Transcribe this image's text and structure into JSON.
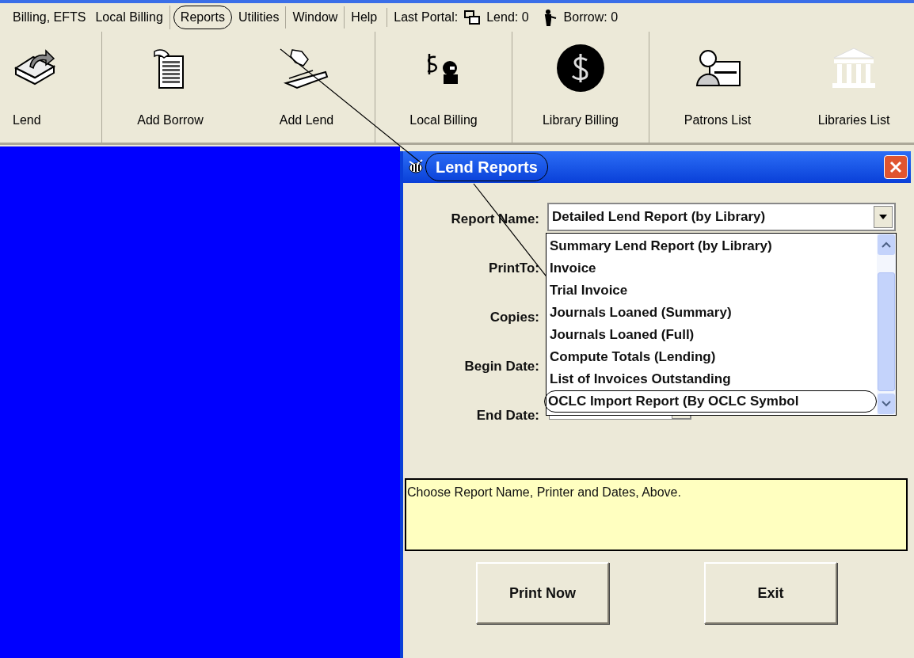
{
  "menu": {
    "groups": [
      [
        {
          "label": "Billing, EFTS",
          "circled": false
        },
        {
          "label": "Local Billing",
          "circled": false
        }
      ],
      [
        {
          "label": "Reports",
          "circled": true
        },
        {
          "label": "Utilities",
          "circled": false
        }
      ],
      [
        {
          "label": "Window",
          "circled": false
        }
      ],
      [
        {
          "label": "Help",
          "circled": false
        }
      ]
    ],
    "last_portal": {
      "label": "Last Portal:",
      "lend": "Lend: 0",
      "borrow": "Borrow: 0"
    }
  },
  "toolbar": {
    "groups": [
      [
        {
          "label": "Lend",
          "kind": "tray"
        }
      ],
      [
        {
          "label": "Add Borrow",
          "kind": "document"
        },
        {
          "label": "Add Lend",
          "kind": "hand"
        }
      ],
      [
        {
          "label": "Local Billing",
          "kind": "dollar-person"
        }
      ],
      [
        {
          "label": "Library Billing",
          "kind": "coin"
        }
      ],
      [
        {
          "label": "Patrons List",
          "kind": "person-board"
        },
        {
          "label": "Libraries List",
          "kind": "building"
        }
      ]
    ]
  },
  "dialog": {
    "title": "Lend Reports",
    "title_circled": true,
    "fields": [
      {
        "label": "Report Name:"
      },
      {
        "label": "PrintTo:"
      },
      {
        "label": "Copies:"
      },
      {
        "label": "Begin Date:"
      },
      {
        "label": "End Date:"
      }
    ],
    "report_name": {
      "value": "Detailed Lend Report (by Library)",
      "expanded": true,
      "options": [
        {
          "label": "Summary Lend Report (by Library)",
          "circled": false
        },
        {
          "label": "Invoice",
          "circled": false
        },
        {
          "label": "Trial Invoice",
          "circled": false
        },
        {
          "label": "Journals Loaned (Summary)",
          "circled": false
        },
        {
          "label": "Journals Loaned (Full)",
          "circled": false
        },
        {
          "label": "Compute Totals (Lending)",
          "circled": false
        },
        {
          "label": "List of Invoices Outstanding",
          "circled": false
        },
        {
          "label": "OCLC Import Report (By OCLC Symbol",
          "circled": true
        }
      ]
    },
    "hint": "Choose Report Name, Printer and Dates, Above.",
    "buttons": [
      "Print Now",
      "Exit"
    ]
  }
}
